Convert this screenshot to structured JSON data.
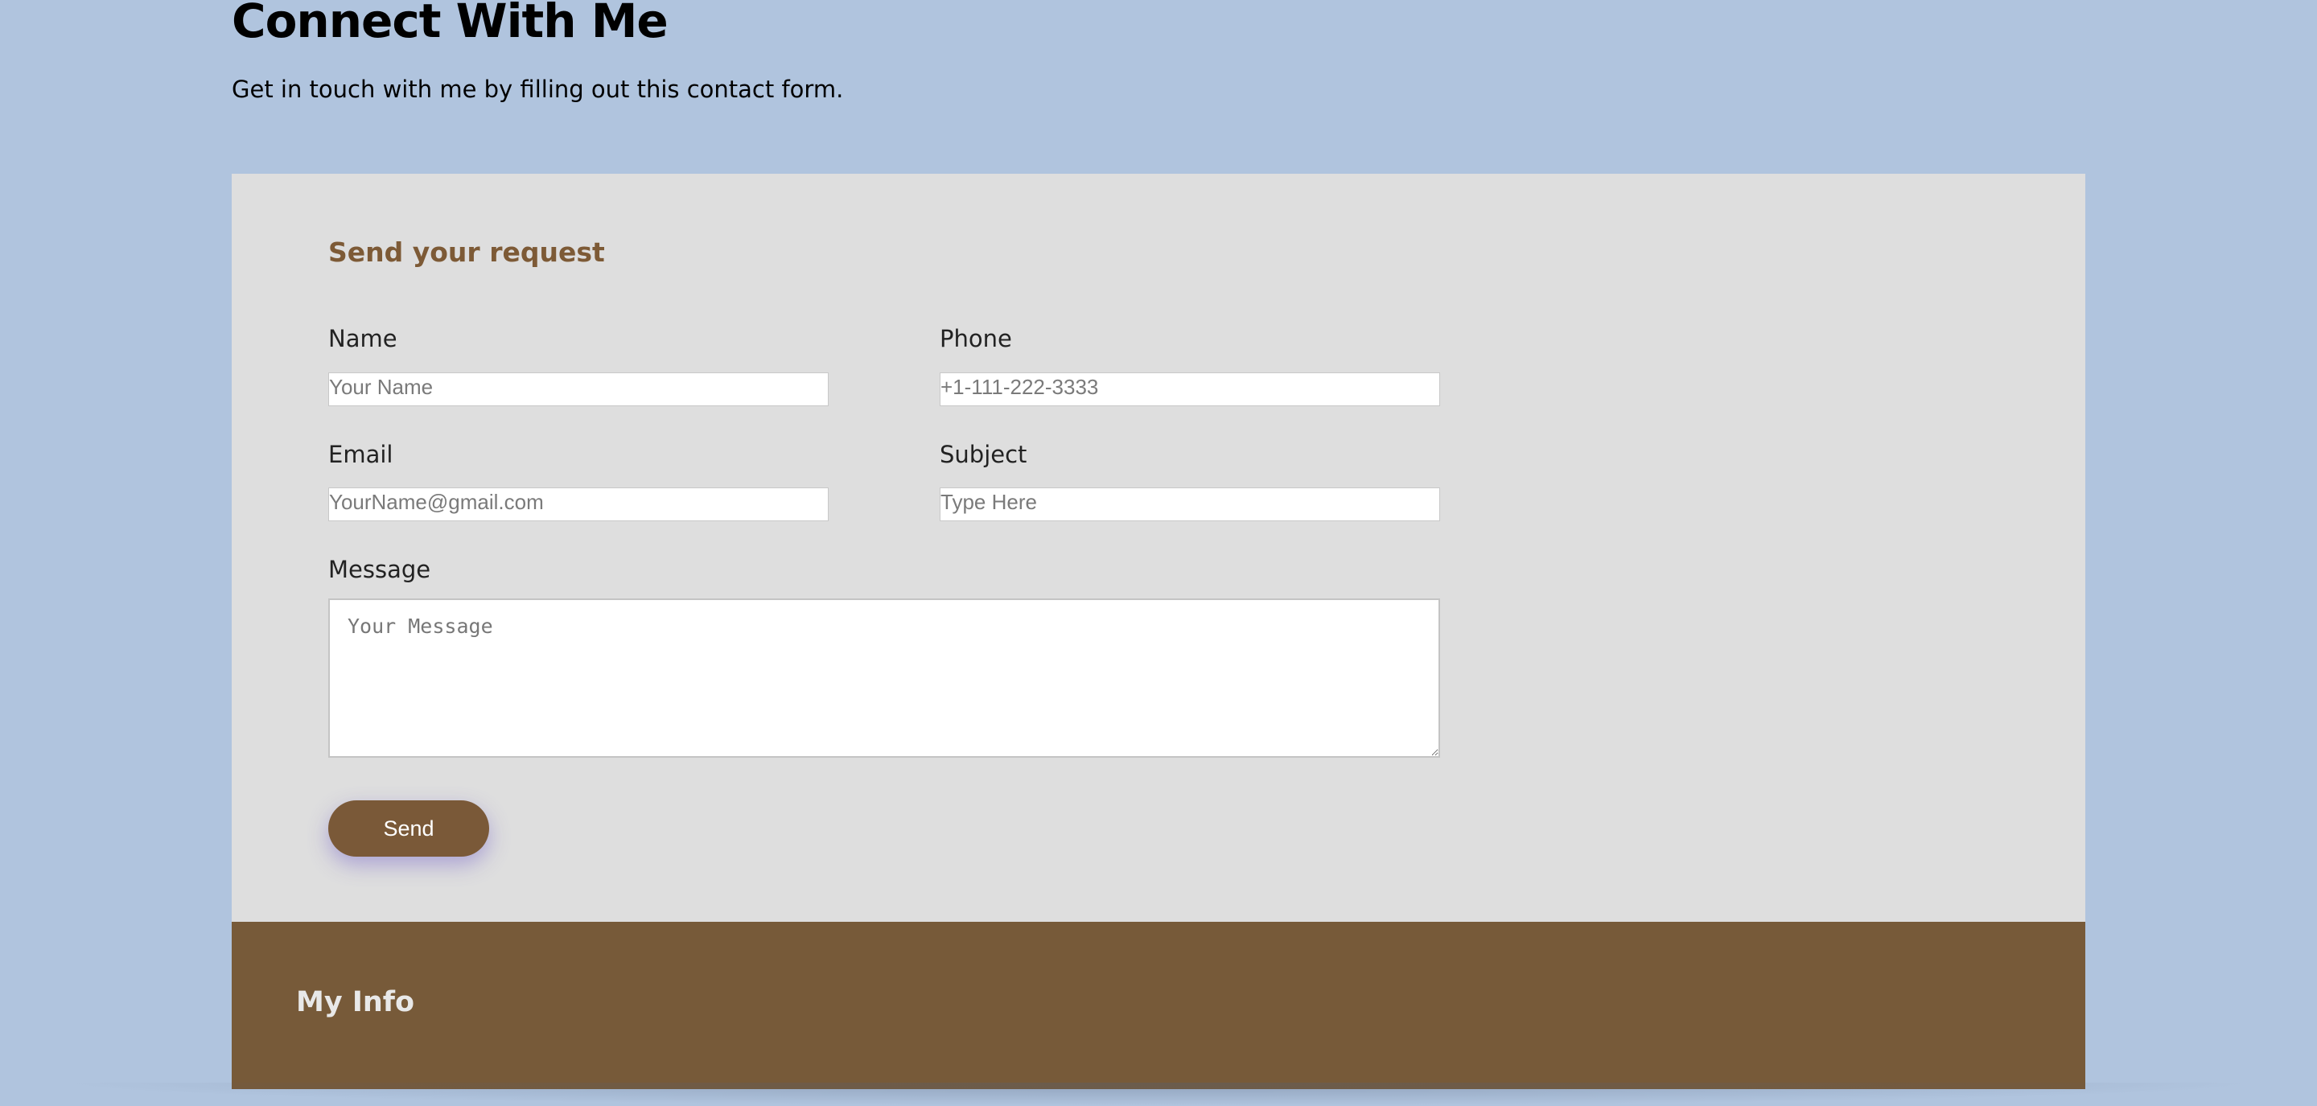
{
  "header": {
    "title": "Connect With Me",
    "subtitle": "Get in touch with me by filling out this contact form."
  },
  "form": {
    "heading": "Send your request",
    "fields": {
      "name": {
        "label": "Name",
        "placeholder": "Your Name",
        "value": ""
      },
      "phone": {
        "label": "Phone",
        "placeholder": "+1-111-222-3333",
        "value": ""
      },
      "email": {
        "label": "Email",
        "placeholder": "YourName@gmail.com",
        "value": ""
      },
      "subject": {
        "label": "Subject",
        "placeholder": "Type Here",
        "value": ""
      },
      "message": {
        "label": "Message",
        "placeholder": "Your Message",
        "value": ""
      }
    },
    "submit_label": "Send"
  },
  "info": {
    "heading": "My Info"
  },
  "colors": {
    "page_background": "#b0c4de",
    "form_background": "#dedede",
    "accent_brown": "#7a5938",
    "heading_brown": "#7d5a36",
    "footer_brown": "#775a39"
  }
}
